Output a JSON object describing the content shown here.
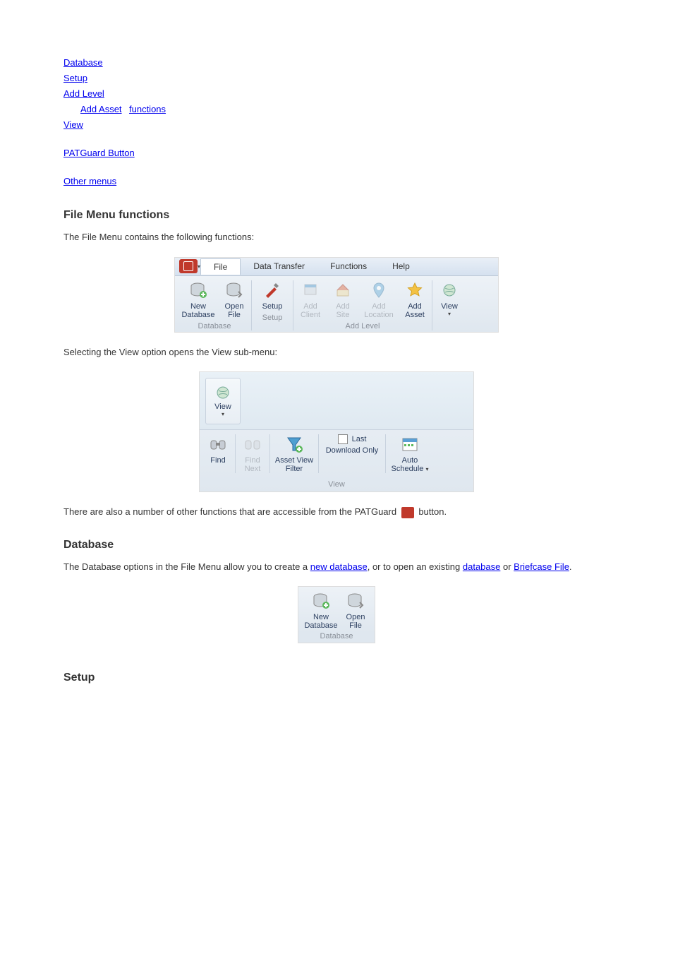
{
  "toc": {
    "items": [
      "Database",
      "Setup",
      "Add Level",
      "Add Asset",
      "View",
      "PATGuard Button",
      "Other menus"
    ],
    "addLevelSub": "functions"
  },
  "file_functions": {
    "heading": "File Menu functions",
    "para1": "The File Menu contains the following functions:"
  },
  "ribbon1": {
    "tabs": {
      "file": "File",
      "dataTransfer": "Data Transfer",
      "functions": "Functions",
      "help": "Help"
    },
    "buttons": {
      "newDatabase": "New Database",
      "openFile": "Open File",
      "setup": "Setup",
      "addClient": "Add Client",
      "addSite": "Add Site",
      "addLocation": "Add Location",
      "addAsset": "Add Asset",
      "view": "View"
    },
    "groups": {
      "database": "Database",
      "setup": "Setup",
      "addLevel": "Add Level"
    }
  },
  "ribbon2": {
    "intro": "Selecting the View option opens the View sub-menu:",
    "view": "View",
    "find": "Find",
    "findNext": "Find Next",
    "assetViewFilter": "Asset View Filter",
    "last": "Last",
    "downloadOnly": "Download Only",
    "autoSchedule": "Auto Schedule",
    "groupLabel": "View"
  },
  "patguard_button": {
    "intro_before": "There are also a number of other functions that are accessible from the PATGuard ",
    "intro_after": "button."
  },
  "database": {
    "heading": "Database",
    "para_before": "The Database options in the File Menu allow you to create a ",
    "link1": "new database",
    "para_mid": ", or to open an existing ",
    "link2": "database",
    "para_or": " or ",
    "link3": "Briefcase File",
    "para_end": "."
  },
  "ribbon3": {
    "newDatabase": "New Database",
    "openFile": "Open File",
    "group": "Database"
  },
  "setup": {
    "heading": "Setup"
  }
}
